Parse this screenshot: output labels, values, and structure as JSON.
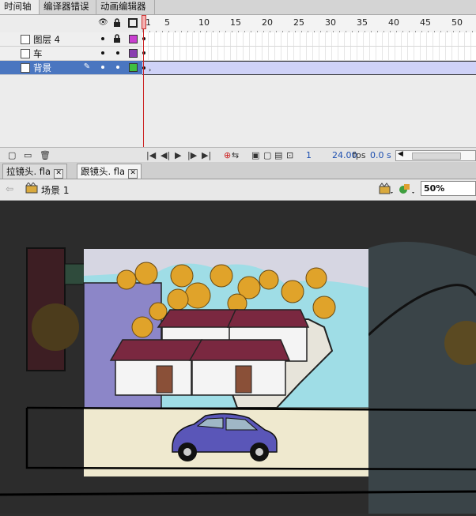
{
  "timeline": {
    "tabs": [
      "时间轴",
      "编译器错误",
      "动画编辑器"
    ],
    "ruler_numbers": [
      "1",
      "5",
      "10",
      "15",
      "20",
      "25",
      "30",
      "35",
      "40",
      "45",
      "50"
    ],
    "layers": [
      {
        "name": "图层 4",
        "color": "#c93fd0"
      },
      {
        "name": "车",
        "color": "#8a3fb0"
      },
      {
        "name": "背景",
        "color": "#3fbf3f"
      }
    ],
    "footer": {
      "frame": "1",
      "fps": "24.00",
      "fps_unit": "fps",
      "time": "0.0 s"
    }
  },
  "documents": {
    "tabs": [
      "拉镜头. fla",
      "跟镜头. fla"
    ],
    "active_tab": 1
  },
  "scene": {
    "label": "场景 1",
    "zoom": "50%"
  },
  "colors": {
    "selected_layer": "#4a76c0",
    "playhead": "#cc2222",
    "roof": "#7a2840",
    "car": "#5a56b8",
    "sky": "#a6e6ee",
    "ground": "#efe9cf"
  }
}
